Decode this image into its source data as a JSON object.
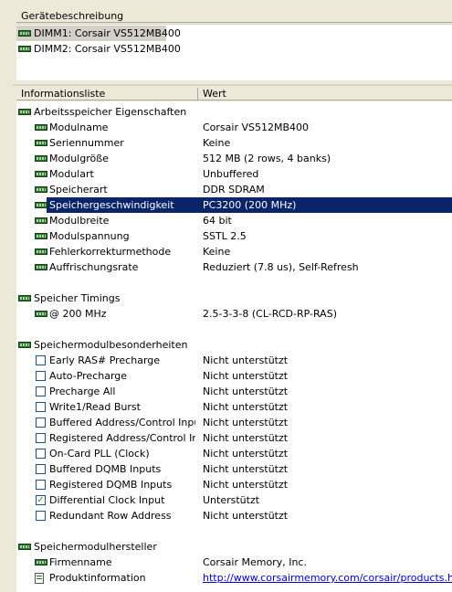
{
  "device_panel": {
    "header": "Gerätebeschreibung",
    "items": [
      {
        "label": "DIMM1: Corsair VS512MB400",
        "selected": true
      },
      {
        "label": "DIMM2: Corsair VS512MB400",
        "selected": false
      }
    ]
  },
  "info_panel": {
    "col_field": "Informationsliste",
    "col_value": "Wert",
    "sections": {
      "props_title": "Arbeitsspeicher Eigenschaften",
      "props": [
        {
          "label": "Modulname",
          "value": "Corsair VS512MB400"
        },
        {
          "label": "Seriennummer",
          "value": "Keine"
        },
        {
          "label": "Modulgröße",
          "value": "512 MB (2 rows, 4 banks)"
        },
        {
          "label": "Modulart",
          "value": "Unbuffered"
        },
        {
          "label": "Speicherart",
          "value": "DDR SDRAM"
        },
        {
          "label": "Speichergeschwindigkeit",
          "value": "PC3200 (200 MHz)"
        },
        {
          "label": "Modulbreite",
          "value": "64 bit"
        },
        {
          "label": "Modulspannung",
          "value": "SSTL 2.5"
        },
        {
          "label": "Fehlerkorrekturmethode",
          "value": "Keine"
        },
        {
          "label": "Auffrischungsrate",
          "value": "Reduziert (7.8 us), Self-Refresh"
        }
      ],
      "timings_title": "Speicher Timings",
      "timings": [
        {
          "label": "@ 200 MHz",
          "value": "2.5-3-3-8  (CL-RCD-RP-RAS)"
        }
      ],
      "features_title": "Speichermodulbesonderheiten",
      "features": [
        {
          "label": "Early RAS# Precharge",
          "value": "Nicht unterstützt",
          "checked": false
        },
        {
          "label": "Auto-Precharge",
          "value": "Nicht unterstützt",
          "checked": false
        },
        {
          "label": "Precharge All",
          "value": "Nicht unterstützt",
          "checked": false
        },
        {
          "label": "Write1/Read Burst",
          "value": "Nicht unterstützt",
          "checked": false
        },
        {
          "label": "Buffered Address/Control Inputs",
          "value": "Nicht unterstützt",
          "checked": false
        },
        {
          "label": "Registered Address/Control In...",
          "value": "Nicht unterstützt",
          "checked": false
        },
        {
          "label": "On-Card PLL (Clock)",
          "value": "Nicht unterstützt",
          "checked": false
        },
        {
          "label": "Buffered DQMB Inputs",
          "value": "Nicht unterstützt",
          "checked": false
        },
        {
          "label": "Registered DQMB Inputs",
          "value": "Nicht unterstützt",
          "checked": false
        },
        {
          "label": "Differential Clock Input",
          "value": "Unterstützt",
          "checked": true
        },
        {
          "label": "Redundant Row Address",
          "value": "Nicht unterstützt",
          "checked": false
        }
      ],
      "manufacturer_title": "Speichermodulhersteller",
      "manufacturer": [
        {
          "label": "Firmenname",
          "value": "Corsair Memory, Inc."
        },
        {
          "label": "Produktinformation",
          "value": "http://www.corsairmemory.com/corsair/products.html"
        }
      ]
    }
  },
  "colors": {
    "selection": "#0a246a",
    "link": "#0000cc",
    "check": "#21a121",
    "memory_icon": "#2f6f2f"
  },
  "icons": {
    "memory": "memory-module-icon",
    "link": "link-page-icon",
    "check": "checkbox"
  }
}
